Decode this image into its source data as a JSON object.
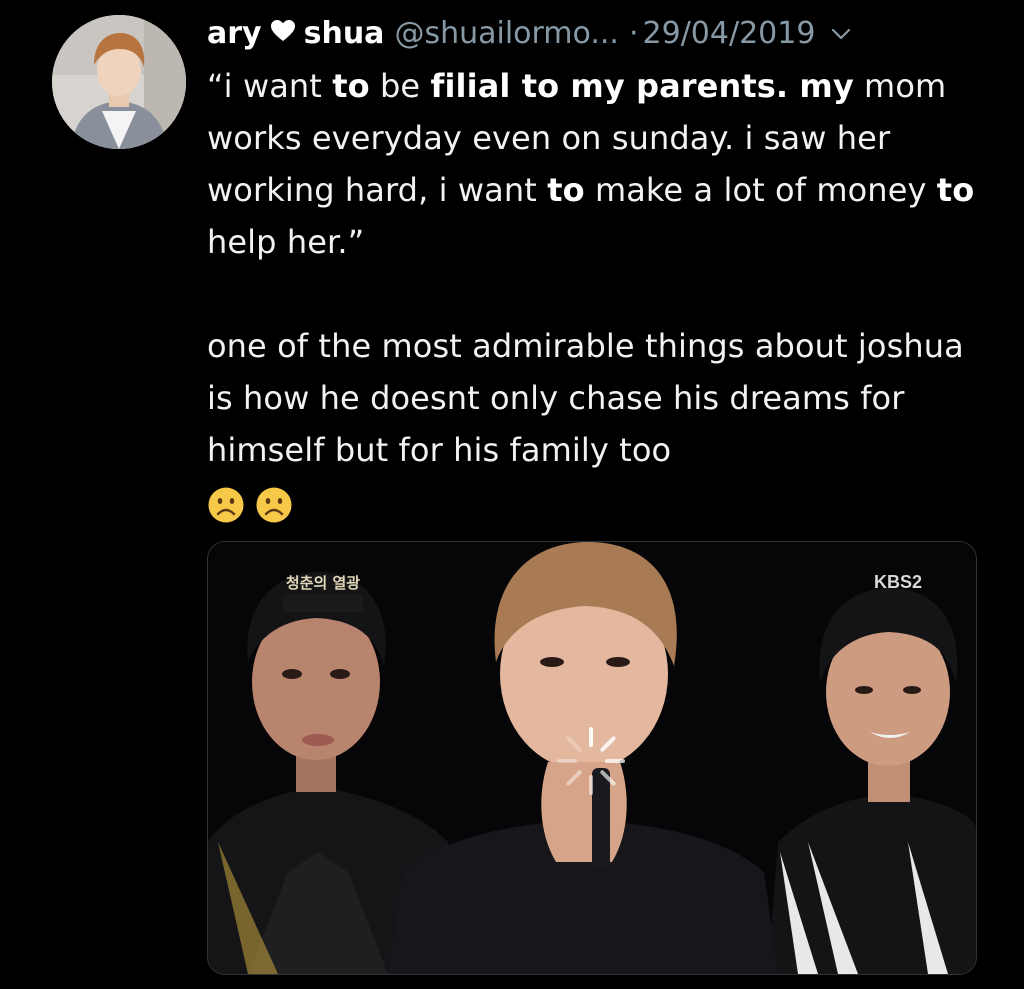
{
  "tweet": {
    "display_name_part1": "ary",
    "display_name_icon": "heart-icon",
    "display_name_part2": "shua",
    "handle": "@shuailormo...",
    "separator": "·",
    "date": "29/04/2019",
    "body": {
      "para1": [
        {
          "text": "“i want ",
          "bold": false
        },
        {
          "text": "to",
          "bold": true
        },
        {
          "text": " be ",
          "bold": false
        },
        {
          "text": "filial to my parents. my",
          "bold": true
        },
        {
          "text": " mom works everyday even on sunday. i saw her working hard, i want ",
          "bold": false
        },
        {
          "text": "to",
          "bold": true
        },
        {
          "text": " make a lot of money ",
          "bold": false
        },
        {
          "text": "to",
          "bold": true
        },
        {
          "text": " help her.”",
          "bold": false
        }
      ],
      "para2": "one of the most admirable things about joshua is how he doesnt only chase his dreams for himself but for his family too",
      "emojis": [
        "frowning-face",
        "frowning-face"
      ]
    },
    "media": {
      "broadcaster_logo": "KBS2",
      "program_logo": "청춘의 열광"
    }
  },
  "colors": {
    "background": "#000000",
    "text": "#f2f2f2",
    "secondary": "#8899a6",
    "emoji": "#f7c948"
  }
}
